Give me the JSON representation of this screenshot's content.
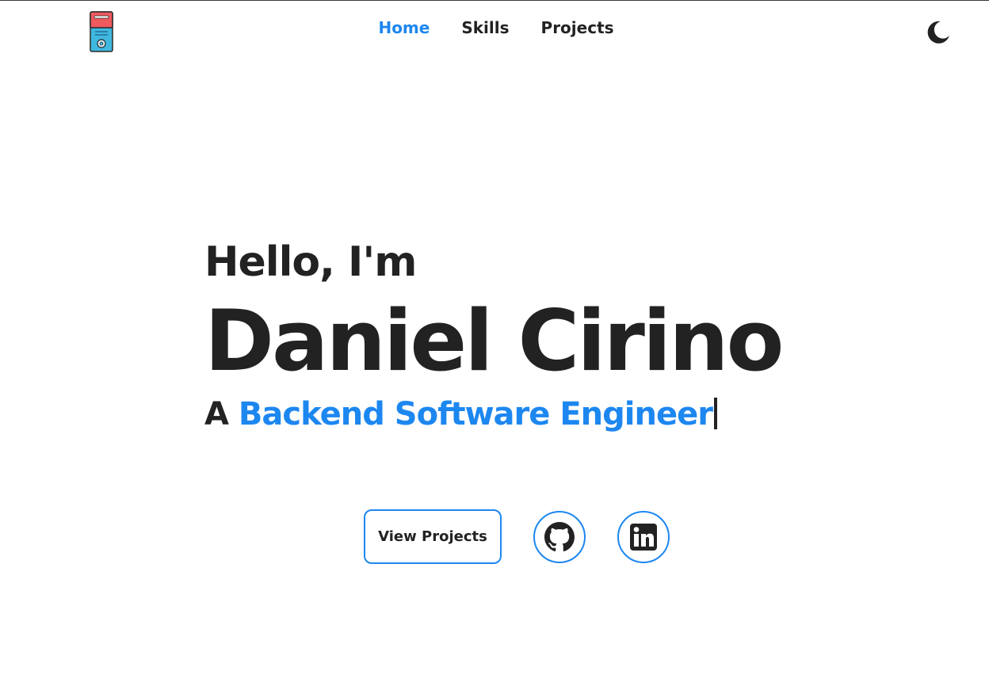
{
  "colors": {
    "accent": "#1d87f0",
    "text": "#222222",
    "background": "#ffffff"
  },
  "header": {
    "logo_icon": "computer-tower-icon",
    "nav": [
      {
        "label": "Home",
        "active": true
      },
      {
        "label": "Skills",
        "active": false
      },
      {
        "label": "Projects",
        "active": false
      }
    ],
    "theme_toggle_icon": "moon-icon"
  },
  "hero": {
    "greeting": "Hello, I'm",
    "name": "Daniel Cirino",
    "tagline_prefix": "A",
    "tagline_role": "Backend Software Engineer"
  },
  "actions": {
    "view_projects_label": "View Projects",
    "github_icon": "github-icon",
    "linkedin_icon": "linkedin-icon"
  }
}
